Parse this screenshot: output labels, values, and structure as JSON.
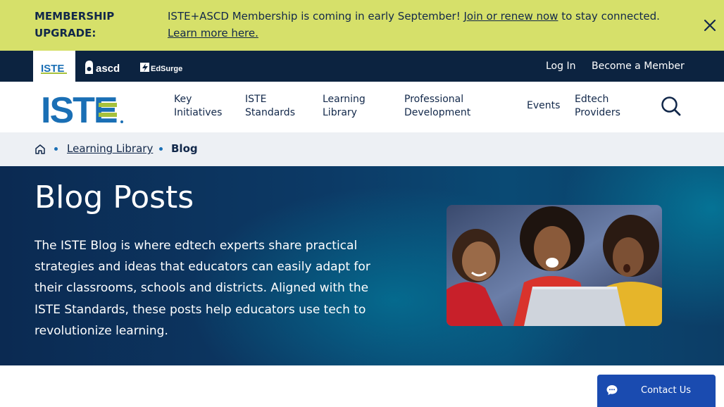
{
  "banner": {
    "title": "MEMBERSHIP UPGRADE:",
    "text_before": "ISTE+ASCD Membership is coming in early September! ",
    "link_join": "Join or renew now",
    "text_middle": " to stay connected. ",
    "link_learn": "Learn more here.",
    "close_icon": "close-icon"
  },
  "brandbar": {
    "brands": [
      "ISTE",
      "ascd",
      "EdSurge"
    ],
    "login": "Log In",
    "member": "Become a Member"
  },
  "nav": {
    "logo": "ISTE",
    "items": [
      {
        "label": "Key Initiatives"
      },
      {
        "label": "ISTE Standards"
      },
      {
        "label": "Learning Library"
      },
      {
        "label": "Professional Development"
      },
      {
        "label": "Events"
      },
      {
        "label": "Edtech Providers"
      }
    ],
    "search_icon": "search-icon"
  },
  "breadcrumb": {
    "home_icon": "home-icon",
    "items": [
      "Learning Library",
      "Blog"
    ]
  },
  "hero": {
    "title": "Blog Posts",
    "description": "The ISTE Blog is where edtech experts share practical strategies and ideas that educators can easily adapt for their classrooms, schools and districts. Aligned with the ISTE Standards, these posts help educators use tech to revolutionize learning."
  },
  "contact": {
    "label": "Contact Us",
    "icon": "chat-icon"
  },
  "colors": {
    "banner_bg": "#d6e06a",
    "navy": "#0c2340",
    "iste_blue": "#1a6fb5",
    "iste_green": "#a7c13c",
    "contact_bg": "#1a4bb0"
  }
}
